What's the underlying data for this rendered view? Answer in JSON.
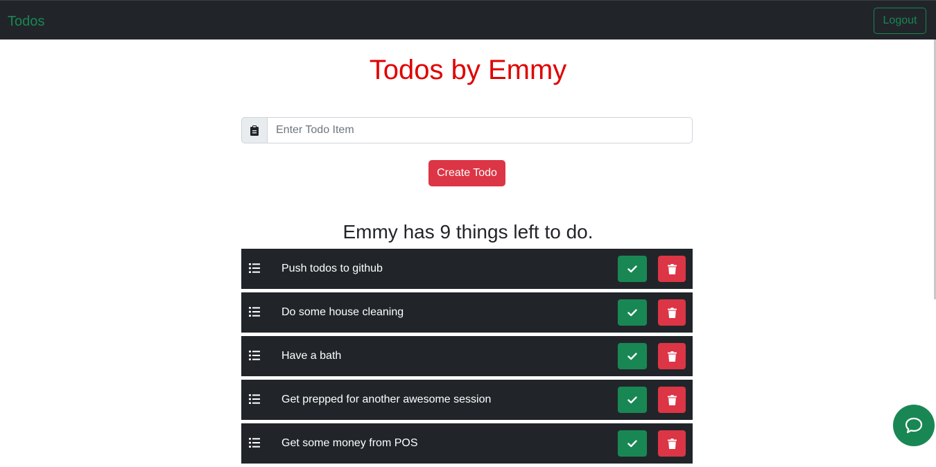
{
  "navbar": {
    "brand": "Todos",
    "logout_label": "Logout"
  },
  "page_title": "Todos by Emmy",
  "form": {
    "input_icon": "clipboard-icon",
    "input_value": "",
    "input_placeholder": "Enter Todo Item",
    "create_label": "Create Todo"
  },
  "summary": "Emmy has 9 things left to do.",
  "todos": [
    {
      "text": "Push todos to github"
    },
    {
      "text": "Do some house cleaning"
    },
    {
      "text": "Have a bath"
    },
    {
      "text": "Get prepped for another awesome session"
    },
    {
      "text": "Get some money from POS"
    }
  ],
  "icons": {
    "item": "list-icon",
    "done": "check-icon",
    "delete": "trash-icon",
    "chat": "chat-bubble-icon"
  },
  "colors": {
    "navbar_bg": "#212529",
    "brand": "#198754",
    "title": "#e00000",
    "success": "#198754",
    "danger": "#dc3545",
    "item_bg": "#212529"
  }
}
